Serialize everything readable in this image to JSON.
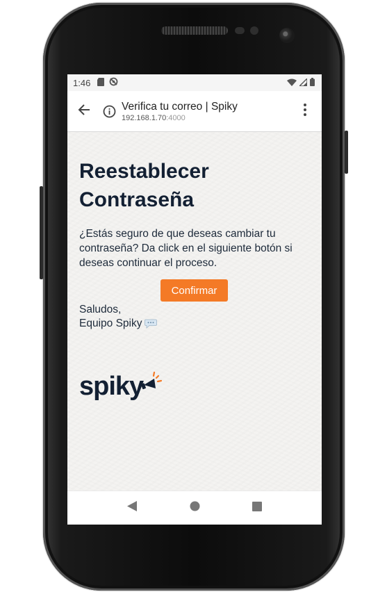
{
  "status_bar": {
    "time": "1:46"
  },
  "browser": {
    "page_title": "Verifica tu correo | Spiky",
    "url_host": "192.168.1.70",
    "url_port": ":4000"
  },
  "email": {
    "heading": "Reestablecer Contraseña",
    "message": "¿Estás seguro de que deseas cambiar tu contraseña? Da click en el siguiente botón si deseas continuar el proceso.",
    "confirm_label": "Confirmar",
    "greeting": "Saludos,",
    "signature": "Equipo Spiky",
    "logo_text": "spiky"
  },
  "colors": {
    "accent": "#f47a26",
    "text_dark": "#132033",
    "background": "#f4f3f1"
  },
  "icons": {
    "back": "arrow-back-icon",
    "info": "info-icon",
    "menu": "more-vert-icon",
    "chat": "speech-bubble-icon",
    "nav_back": "triangle-back-icon",
    "nav_home": "circle-home-icon",
    "nav_recent": "square-recent-icon"
  }
}
